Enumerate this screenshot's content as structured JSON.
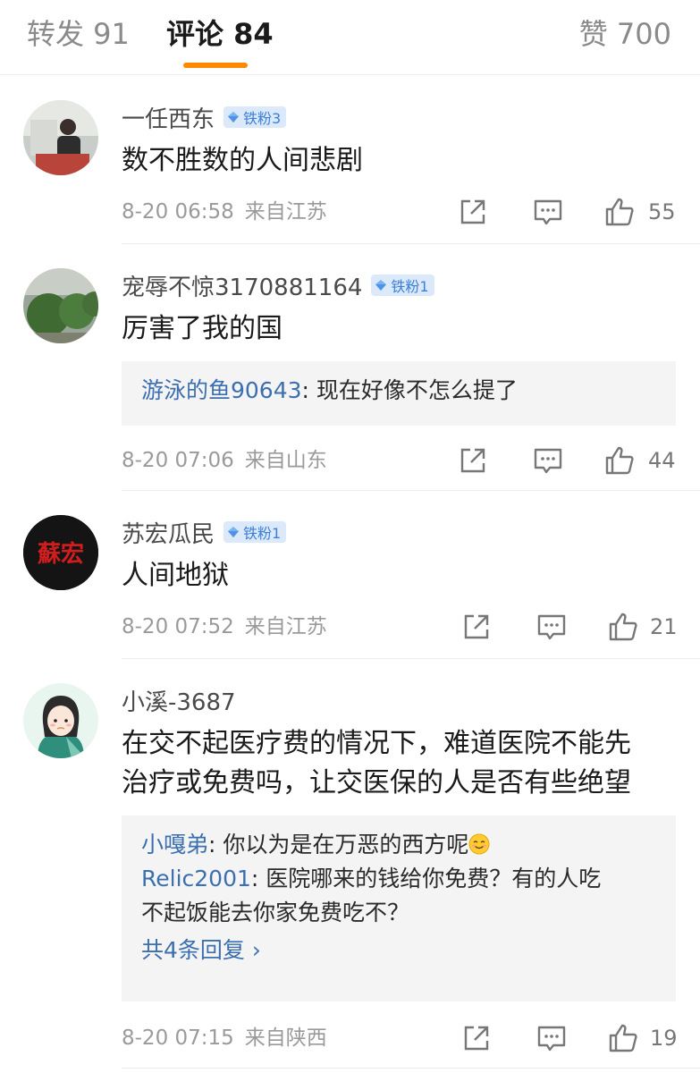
{
  "tabs": {
    "repost": "转发 91",
    "comments": "评论 84",
    "likes": "赞 700"
  },
  "accent_color": "#ff8a00",
  "link_color": "#3b6fb0",
  "comments": [
    {
      "username": "一任西东",
      "badge": "铁粉3",
      "text": "数不胜数的人间悲剧",
      "time": "8-20 06:58",
      "location": "来自江苏",
      "likes": "55"
    },
    {
      "username": "宠辱不惊3170881164",
      "badge": "铁粉1",
      "text": "厉害了我的国",
      "replies": [
        {
          "name": "游泳的鱼90643",
          "text": ": 现在好像不怎么提了"
        }
      ],
      "time": "8-20 07:06",
      "location": "来自山东",
      "likes": "44"
    },
    {
      "username": "苏宏瓜民",
      "badge": "铁粉1",
      "avatar_text": "蘇宏",
      "text": "人间地狱",
      "time": "8-20 07:52",
      "location": "来自江苏",
      "likes": "21"
    },
    {
      "username": "小溪-3687",
      "text_line1": "在交不起医疗费的情况下，难道医院不能先",
      "text_line2": "治疗或免费吗，让交医保的人是否有些绝望",
      "replies": [
        {
          "name": "小嘎弟",
          "text": ": 你以为是在万恶的西方呢",
          "emoji": "smiling-face-emoji"
        },
        {
          "name": "Relic2001",
          "text": ": 医院哪来的钱给你免费？有的人吃",
          "text2": "不起饭能去你家免费吃不？"
        }
      ],
      "more_replies": "共4条回复 ›",
      "time": "8-20 07:15",
      "location": "来自陕西",
      "likes": "19"
    }
  ],
  "icons": {
    "share": "share-icon",
    "comment": "comment-icon",
    "like": "thumbs-up-icon",
    "badge": "diamond-icon"
  }
}
